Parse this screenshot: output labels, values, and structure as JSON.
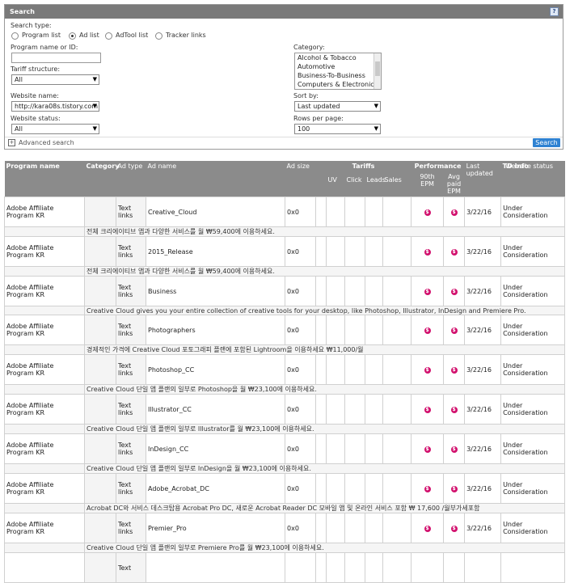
{
  "panel": {
    "title": "Search",
    "help_icon": "question-icon"
  },
  "search_type": {
    "label": "Search type:",
    "options": [
      "Program list",
      "Ad list",
      "AdTool list",
      "Tracker links"
    ],
    "selected": "Ad list"
  },
  "fields": {
    "program_label": "Program name or ID:",
    "program_value": "",
    "tariff_label": "Tariff structure:",
    "tariff_value": "All",
    "website_label": "Website name:",
    "website_value": "http://kara08s.tistory.com",
    "status_label": "Website status:",
    "status_value": "All",
    "category_label": "Category:",
    "category_options": [
      "Alcohol & Tobacco",
      "Automotive",
      "Business-To-Business",
      "Computers & Electronics"
    ],
    "sort_label": "Sort by:",
    "sort_value": "Last updated",
    "rows_label": "Rows per page:",
    "rows_value": "100"
  },
  "advanced": "Advanced search",
  "search_button": "Search",
  "table": {
    "headers": {
      "program": "Program name",
      "category": "Category",
      "adtype": "Ad type",
      "adname": "Ad name",
      "adsize": "Ad size",
      "tariffs": "Tariffs",
      "uv": "UV",
      "click": "Click",
      "leads": "Leads",
      "sales": "Sales",
      "performance": "Performance",
      "epm90": "90th EPM",
      "avgpaid": "Avg paid EPM",
      "updated": "Last updated",
      "td": "TD info",
      "status": "Website status"
    },
    "rows": [
      {
        "program": "Adobe Affiliate Program KR",
        "type": "Text links",
        "name": "Creative_Cloud",
        "size": "0x0",
        "updated": "3/22/16",
        "status": "Under Consideration",
        "desc": "전체 크리에이티브 앱과 다양한 서비스를 월 ₩59,400에 이용하세요."
      },
      {
        "program": "Adobe Affiliate Program KR",
        "type": "Text links",
        "name": "2015_Release",
        "size": "0x0",
        "updated": "3/22/16",
        "status": "Under Consideration",
        "desc": "전체 크리에이티브 앱과 다양한 서비스를 월 ₩59,400에 이용하세요."
      },
      {
        "program": "Adobe Affiliate Program KR",
        "type": "Text links",
        "name": "Business",
        "size": "0x0",
        "updated": "3/22/16",
        "status": "Under Consideration",
        "desc": "Creative Cloud gives you your entire collection of creative tools for your desktop, like Photoshop, Illustrator, InDesign and Premiere Pro."
      },
      {
        "program": "Adobe Affiliate Program KR",
        "type": "Text links",
        "name": "Photographers",
        "size": "0x0",
        "updated": "3/22/16",
        "status": "Under Consideration",
        "desc": "경제적인 가격에 Creative Cloud 포토그래피 플랜에 포함된 Lightroom을 이용하세요 ₩11,000/월"
      },
      {
        "program": "Adobe Affiliate Program KR",
        "type": "Text links",
        "name": "Photoshop_CC",
        "size": "0x0",
        "updated": "3/22/16",
        "status": "Under Consideration",
        "desc": "Creative Cloud 단일 앱 플랜의 일부로 Photoshop을 월 ₩23,100에 이용하세요."
      },
      {
        "program": "Adobe Affiliate Program KR",
        "type": "Text links",
        "name": "Illustrator_CC",
        "size": "0x0",
        "updated": "3/22/16",
        "status": "Under Consideration",
        "desc": "Creative Cloud 단일 앱 플랜의 일부로 Illustrator를 월 ₩23,100에 이용하세요."
      },
      {
        "program": "Adobe Affiliate Program KR",
        "type": "Text links",
        "name": "InDesign_CC",
        "size": "0x0",
        "updated": "3/22/16",
        "status": "Under Consideration",
        "desc": "Creative Cloud 단일 앱 플랜의 일부로 InDesign을 월 ₩23,100에 이용하세요."
      },
      {
        "program": "Adobe Affiliate Program KR",
        "type": "Text links",
        "name": "Adobe_Acrobat_DC",
        "size": "0x0",
        "updated": "3/22/16",
        "status": "Under Consideration",
        "desc": "Acrobat DC와 서비스 데스크탑용 Acrobat Pro DC, 새로운 Acrobat Reader DC 모바일 앱 및 온라인 서비스 포함 ₩ 17,600 /월부가세포함"
      },
      {
        "program": "Adobe Affiliate Program KR",
        "type": "Text links",
        "name": "Premier_Pro",
        "size": "0x0",
        "updated": "3/22/16",
        "status": "Under Consideration",
        "desc": "Creative Cloud 단일 앱 플랜의 일부로 Premiere Pro를 월 ₩23,100에 이용하세요."
      },
      {
        "program": "",
        "type": "Text",
        "name": "",
        "size": "",
        "updated": "",
        "status": "",
        "desc": ""
      }
    ]
  }
}
